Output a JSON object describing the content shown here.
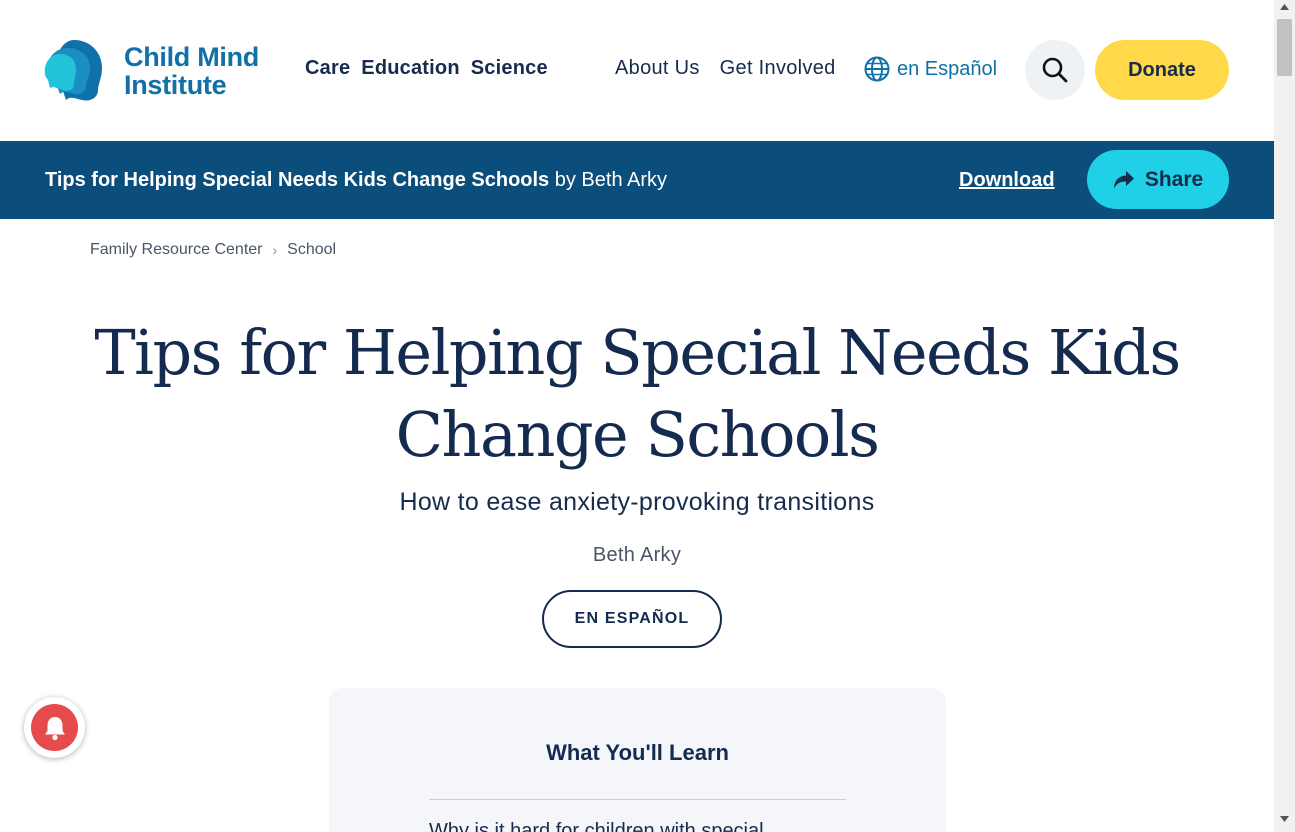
{
  "brand": {
    "logo_line1": "Child Mind",
    "logo_line2": "Institute",
    "color": "#1070a8"
  },
  "nav": {
    "primary": [
      "Care",
      "Education",
      "Science"
    ],
    "secondary": [
      "About Us",
      "Get Involved"
    ],
    "language": "en Español",
    "search_icon": "search-icon",
    "donate_label": "Donate"
  },
  "sticky": {
    "title": "Tips for Helping Special Needs Kids Change Schools",
    "byline": " by Beth Arky",
    "download_label": "Download",
    "share_label": "Share",
    "bg_color": "#0b4e7c",
    "share_color": "#1fd0e6"
  },
  "breadcrumb": {
    "items": [
      "Family Resource Center",
      "School"
    ]
  },
  "article": {
    "title_line1": "Tips for Helping Special Needs Kids",
    "title_line2": "Change Schools",
    "subtitle": "How to ease anxiety-provoking transitions",
    "author": "Beth Arky",
    "espanol_button": "EN ESPAÑOL"
  },
  "learn": {
    "heading": "What You'll Learn",
    "first_item": "Why is it hard for children with special"
  },
  "colors": {
    "donate": "#ffd94a",
    "title": "#142a4e",
    "notification": "#e54b4d"
  }
}
